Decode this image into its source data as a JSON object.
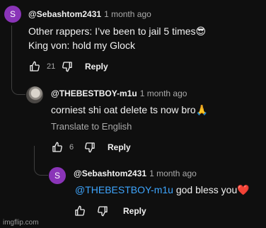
{
  "comments": [
    {
      "avatar_letter": "S",
      "avatar_color": "#8a34b8",
      "author": "@Sebashtom2431",
      "time": "1 month ago",
      "lines": [
        "Other rappers: I’ve been to jail 5 times😎",
        "King von: hold my Glock"
      ],
      "likes": "21",
      "reply_label": "Reply"
    },
    {
      "author": "@THEBESTBOY-m1u",
      "time": "1 month ago",
      "text": "corniest shi oat delete ts now bro🙏",
      "translate_label": "Translate to English",
      "likes": "6",
      "reply_label": "Reply"
    },
    {
      "avatar_letter": "S",
      "avatar_color": "#8a34b8",
      "author": "@Sebashtom2431",
      "time": "1 month ago",
      "mention": "@THEBESTBOY-m1u",
      "text": " god bless you❤️",
      "reply_label": "Reply"
    }
  ],
  "watermark": "imgflip.com"
}
